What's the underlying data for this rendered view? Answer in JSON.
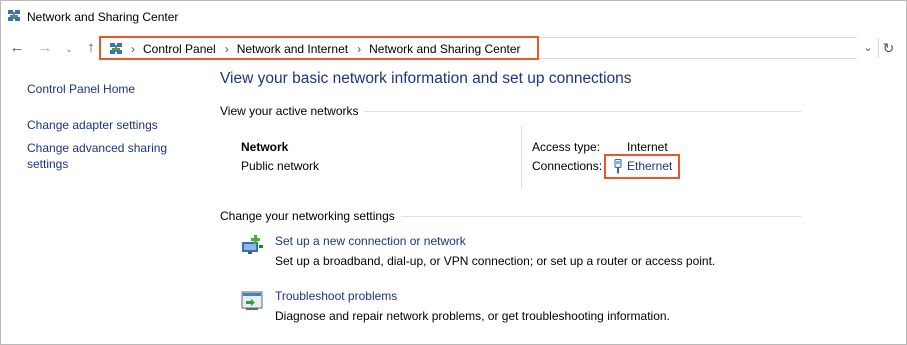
{
  "window": {
    "title": "Network and Sharing Center"
  },
  "nav": {
    "back_glyph": "←",
    "forward_glyph": "→",
    "recent_glyph": "⌄",
    "up_glyph": "↑",
    "dropdown_glyph": "⌄",
    "refresh_glyph": "↻"
  },
  "breadcrumb": {
    "separator": "›",
    "items": [
      "Control Panel",
      "Network and Internet",
      "Network and Sharing Center"
    ]
  },
  "left_pane": {
    "home": "Control Panel Home",
    "adapter": "Change adapter settings",
    "advanced": "Change advanced sharing settings"
  },
  "main": {
    "title": "View your basic network information and set up connections",
    "active_section": "View your active networks",
    "network": {
      "name": "Network",
      "type": "Public network",
      "access_label": "Access type:",
      "access_value": "Internet",
      "connections_label": "Connections:",
      "connection_name": "Ethernet"
    },
    "change_section": "Change your networking settings",
    "tasks": [
      {
        "link": "Set up a new connection or network",
        "description": "Set up a broadband, dial-up, or VPN connection; or set up a router or access point.",
        "icon": "new-connection-icon"
      },
      {
        "link": "Troubleshoot problems",
        "description": "Diagnose and repair network problems, or get troubleshooting information.",
        "icon": "troubleshoot-icon"
      }
    ]
  },
  "colors": {
    "link": "#1e3287",
    "highlight": "#e8572a",
    "divider": "#d5dfe5"
  }
}
